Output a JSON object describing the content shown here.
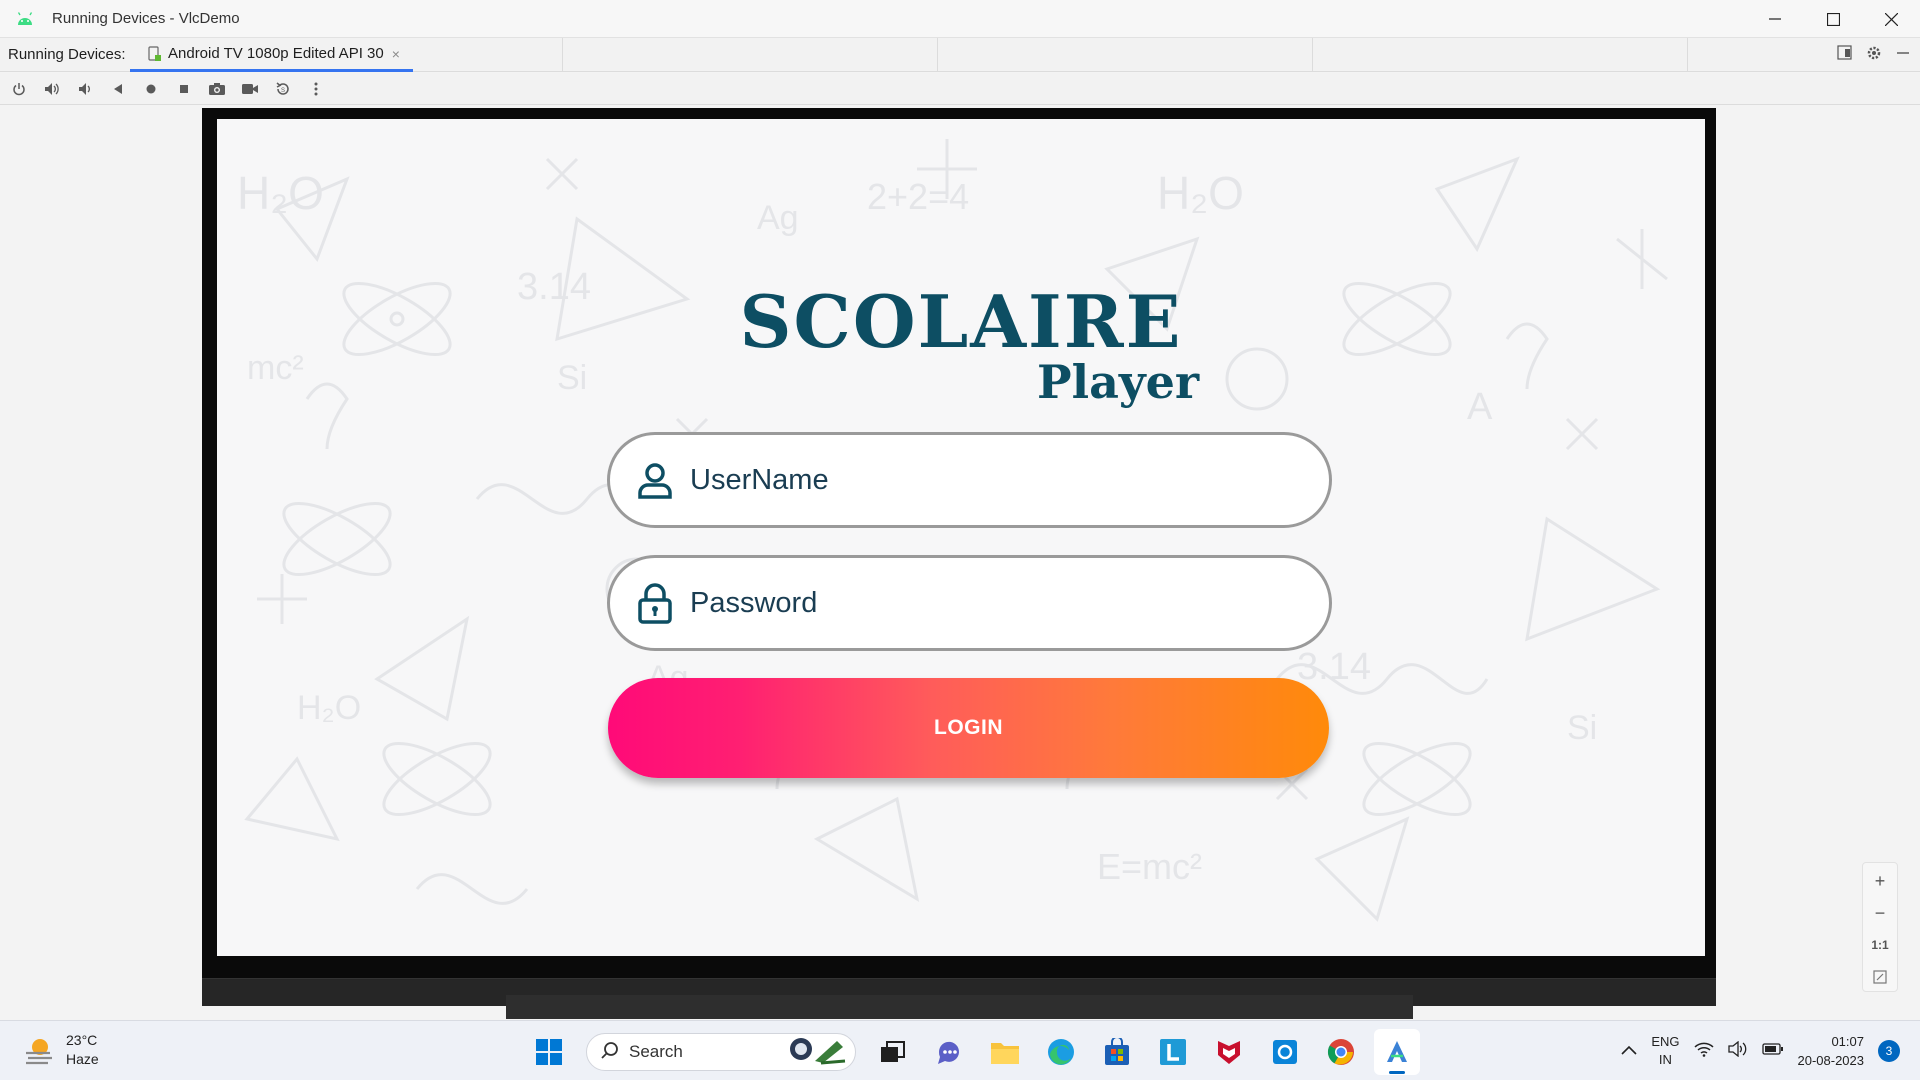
{
  "window": {
    "title": "Running Devices - VlcDemo"
  },
  "tabs": {
    "label": "Running Devices:",
    "active_tab": "Android TV 1080p Edited API 30",
    "close_symbol": "×"
  },
  "toolbar": {
    "icons": [
      "power-icon",
      "volume-up-icon",
      "volume-down-icon",
      "back-icon",
      "home-icon",
      "overview-icon",
      "screenshot-icon",
      "screen-record-icon",
      "reset-icon",
      "more-icon"
    ]
  },
  "app": {
    "logo_main": "SCOLAIRE",
    "logo_sub": "Player",
    "username_placeholder": "UserName",
    "password_placeholder": "Password",
    "login_label": "LOGIN",
    "brand_color": "#0d4e63",
    "gradient_start": "#ff0a78",
    "gradient_end": "#ff8a0a"
  },
  "zoom": {
    "plus": "+",
    "minus": "−",
    "one_to_one": "1:1"
  },
  "taskbar": {
    "weather_temp": "23°C",
    "weather_desc": "Haze",
    "search_label": "Search",
    "lang_line1": "ENG",
    "lang_line2": "IN",
    "time": "01:07",
    "date": "20-08-2023",
    "notification_count": "3"
  }
}
